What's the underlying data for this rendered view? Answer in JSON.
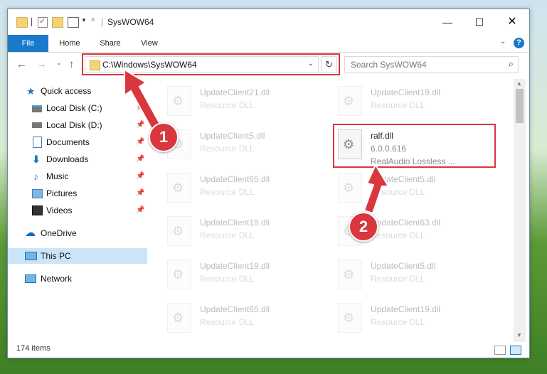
{
  "window": {
    "title": "SysWOW64",
    "controls": {
      "minimize": "—",
      "maximize": "☐",
      "close": "✕"
    }
  },
  "ribbon": {
    "tabs": [
      "File",
      "Home",
      "Share",
      "View"
    ],
    "help": "?"
  },
  "address": {
    "path": "C:\\Windows\\SysWOW64"
  },
  "search": {
    "placeholder": "Search SysWOW64"
  },
  "nav": {
    "items": [
      {
        "label": "Quick access",
        "icon": "star-icon",
        "pinned": false
      },
      {
        "label": "Local Disk (C:)",
        "icon": "drive-icon",
        "pinned": true
      },
      {
        "label": "Local Disk (D:)",
        "icon": "drive-icon",
        "pinned": true
      },
      {
        "label": "Documents",
        "icon": "documents-icon",
        "pinned": true
      },
      {
        "label": "Downloads",
        "icon": "downloads-icon",
        "pinned": true
      },
      {
        "label": "Music",
        "icon": "music-icon",
        "pinned": true
      },
      {
        "label": "Pictures",
        "icon": "pictures-icon",
        "pinned": true
      },
      {
        "label": "Videos",
        "icon": "videos-icon",
        "pinned": true
      },
      {
        "label": "OneDrive",
        "icon": "onedrive-icon",
        "pinned": false
      },
      {
        "label": "This PC",
        "icon": "this-pc-icon",
        "pinned": false,
        "selected": true
      },
      {
        "label": "Network",
        "icon": "network-icon",
        "pinned": false
      }
    ]
  },
  "files": {
    "left": [
      {
        "name": "UpdateClient21.dll",
        "desc": "Resource DLL"
      },
      {
        "name": "UpdateClient5.dll",
        "desc": "Resource DLL"
      },
      {
        "name": "UpdateClient65.dll",
        "desc": "Resource DLL"
      },
      {
        "name": "UpdateClient19.dll",
        "desc": "Resource DLL"
      },
      {
        "name": "UpdateClient19.dll",
        "desc": "Resource DLL"
      },
      {
        "name": "UpdateClient65.dll",
        "desc": "Resource DLL"
      }
    ],
    "right": [
      {
        "name": "UpdateClient19.dll",
        "desc": "Resource DLL"
      },
      {
        "name": "UpdateClient5.dll",
        "desc": "Resource DLL"
      },
      {
        "name": "UpdateClient63.dll",
        "desc": "Resource DLL"
      },
      {
        "name": "UpdateClient5.dll",
        "desc": "Resource DLL"
      },
      {
        "name": "UpdateClient19.dll",
        "desc": "Resource DLL"
      }
    ],
    "highlighted": {
      "name": "ralf.dll",
      "version": "6.0.0.616",
      "description": "RealAudio Lossless ..."
    }
  },
  "status": {
    "count": "174 items"
  },
  "annotations": {
    "step1": "1",
    "step2": "2",
    "color": "#d9363e"
  }
}
